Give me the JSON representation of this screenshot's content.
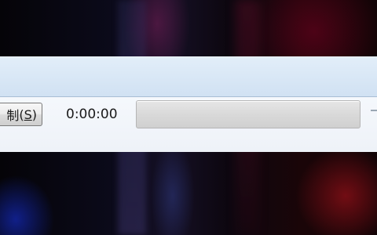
{
  "recorder": {
    "record_button": {
      "label": "制",
      "mnemonic": "S"
    },
    "elapsed_time": "0:00:00",
    "progress": {
      "fraction": 0
    }
  }
}
